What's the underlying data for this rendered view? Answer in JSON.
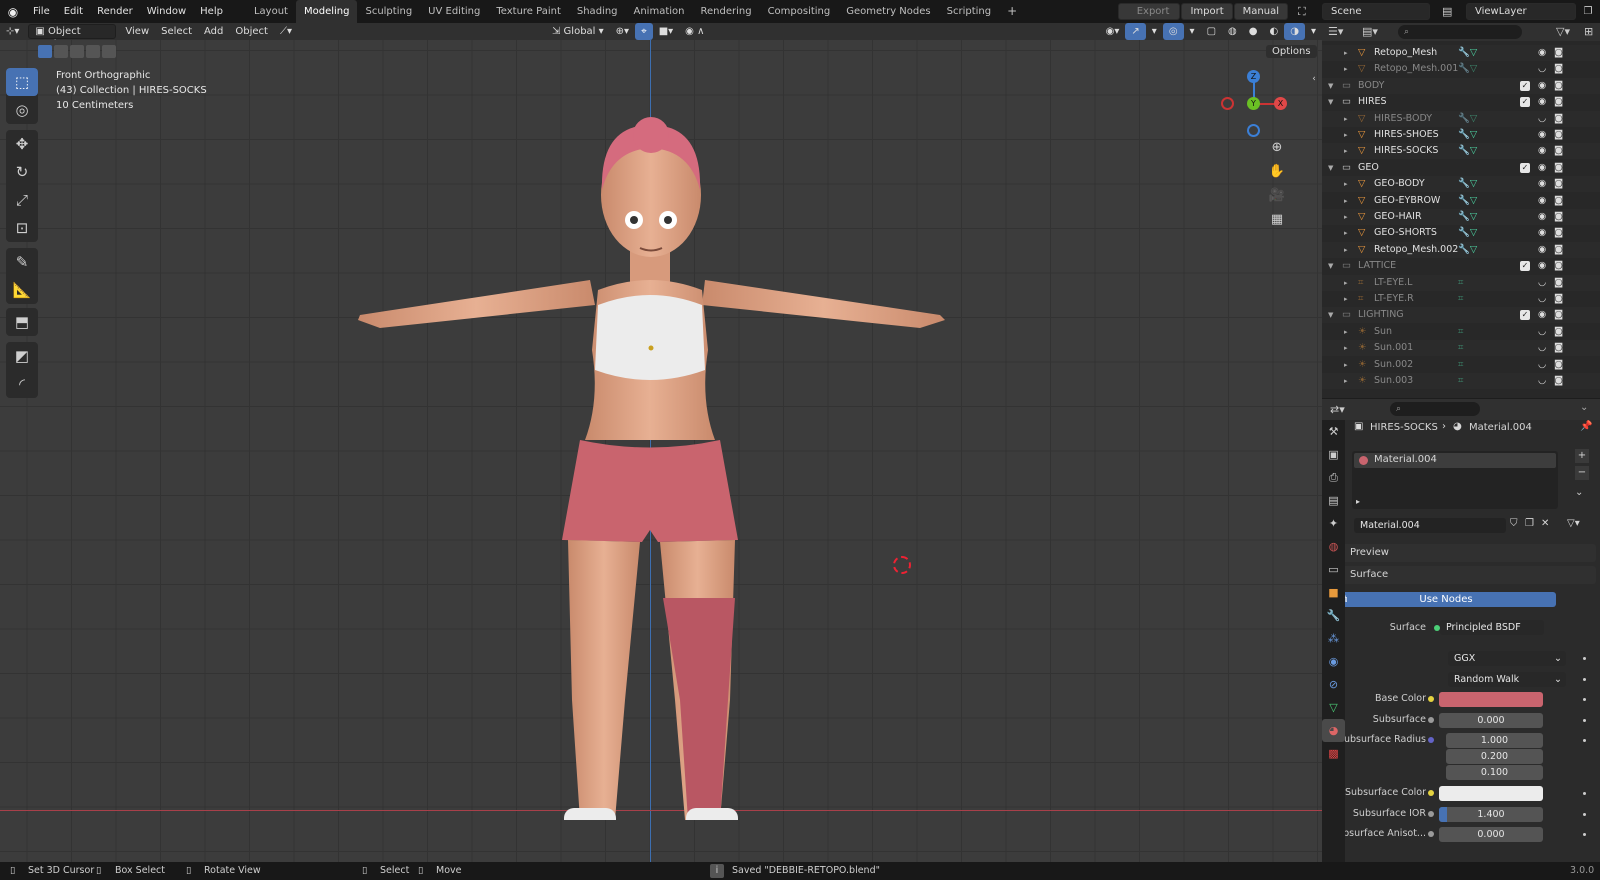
{
  "topbar": {
    "menus": [
      "File",
      "Edit",
      "Render",
      "Window",
      "Help"
    ],
    "workspaces": [
      "Layout",
      "Modeling",
      "Sculpting",
      "UV Editing",
      "Texture Paint",
      "Shading",
      "Animation",
      "Rendering",
      "Compositing",
      "Geometry Nodes",
      "Scripting"
    ],
    "active_workspace": "Modeling",
    "export_label": "Export",
    "import_label": "Import",
    "manual_label": "Manual",
    "scene": "Scene",
    "view_layer": "ViewLayer"
  },
  "viewport_header": {
    "mode": "Object Mode",
    "menus": [
      "View",
      "Select",
      "Add",
      "Object"
    ],
    "transform": "Global",
    "options": "Options"
  },
  "viewport": {
    "view_name": "Front Orthographic",
    "collection_info": "(43) Collection | HIRES-SOCKS",
    "grid_scale": "10 Centimeters",
    "gizmo": {
      "x": "X",
      "y": "Y",
      "z": "Z"
    }
  },
  "outliner": {
    "rows": [
      {
        "name": "Retopo_Mesh",
        "type": "mesh",
        "indent": 2,
        "dim": false
      },
      {
        "name": "Retopo_Mesh.001",
        "type": "mesh",
        "indent": 2,
        "dim": true
      },
      {
        "name": "BODY",
        "type": "collection",
        "indent": 1,
        "dim": true
      },
      {
        "name": "HIRES",
        "type": "collection",
        "indent": 1,
        "dim": false
      },
      {
        "name": "HIRES-BODY",
        "type": "mesh",
        "indent": 2,
        "dim": true
      },
      {
        "name": "HIRES-SHOES",
        "type": "mesh",
        "indent": 2,
        "dim": false
      },
      {
        "name": "HIRES-SOCKS",
        "type": "mesh",
        "indent": 2,
        "dim": false
      },
      {
        "name": "GEO",
        "type": "collection",
        "indent": 1,
        "dim": false
      },
      {
        "name": "GEO-BODY",
        "type": "mesh",
        "indent": 2,
        "dim": false
      },
      {
        "name": "GEO-EYBROW",
        "type": "mesh",
        "indent": 2,
        "dim": false
      },
      {
        "name": "GEO-HAIR",
        "type": "mesh",
        "indent": 2,
        "dim": false
      },
      {
        "name": "GEO-SHORTS",
        "type": "mesh",
        "indent": 2,
        "dim": false
      },
      {
        "name": "Retopo_Mesh.002",
        "type": "mesh",
        "indent": 2,
        "dim": false
      },
      {
        "name": "LATTICE",
        "type": "collection",
        "indent": 1,
        "dim": true
      },
      {
        "name": "LT-EYE.L",
        "type": "lattice",
        "indent": 2,
        "dim": true
      },
      {
        "name": "LT-EYE.R",
        "type": "lattice",
        "indent": 2,
        "dim": true
      },
      {
        "name": "LIGHTING",
        "type": "collection",
        "indent": 1,
        "dim": true
      },
      {
        "name": "Sun",
        "type": "light",
        "indent": 2,
        "dim": true
      },
      {
        "name": "Sun.001",
        "type": "light",
        "indent": 2,
        "dim": true
      },
      {
        "name": "Sun.002",
        "type": "light",
        "indent": 2,
        "dim": true
      },
      {
        "name": "Sun.003",
        "type": "light",
        "indent": 2,
        "dim": true
      }
    ]
  },
  "properties": {
    "breadcrumb_object": "HIRES-SOCKS",
    "breadcrumb_material": "Material.004",
    "slot_name": "Material.004",
    "material_name": "Material.004",
    "preview_label": "Preview",
    "surface_label": "Surface",
    "use_nodes_label": "Use Nodes",
    "surface_field_label": "Surface",
    "surface_shader": "Principled BSDF",
    "distribution": "GGX",
    "subsurface_method": "Random Walk",
    "base_color_label": "Base Color",
    "base_color": "#c9646e",
    "subsurface_label": "Subsurface",
    "subsurface_value": "0.000",
    "subsurface_radius_label": "Subsurface Radius",
    "subsurface_radius": [
      "1.000",
      "0.200",
      "0.100"
    ],
    "subsurface_color_label": "Subsurface Color",
    "subsurface_color": "#ececec",
    "subsurface_ior_label": "Subsurface IOR",
    "subsurface_ior": "1.400",
    "subsurface_ior_fill": 0.08,
    "subsurface_aniso_label": "Subsurface Anisot...",
    "subsurface_aniso": "0.000"
  },
  "statusbar": {
    "items": [
      "Set 3D Cursor",
      "Box Select",
      "Rotate View",
      "Select",
      "Move"
    ],
    "message": "Saved \"DEBBIE-RETOPO.blend\"",
    "version": "3.0.0"
  }
}
